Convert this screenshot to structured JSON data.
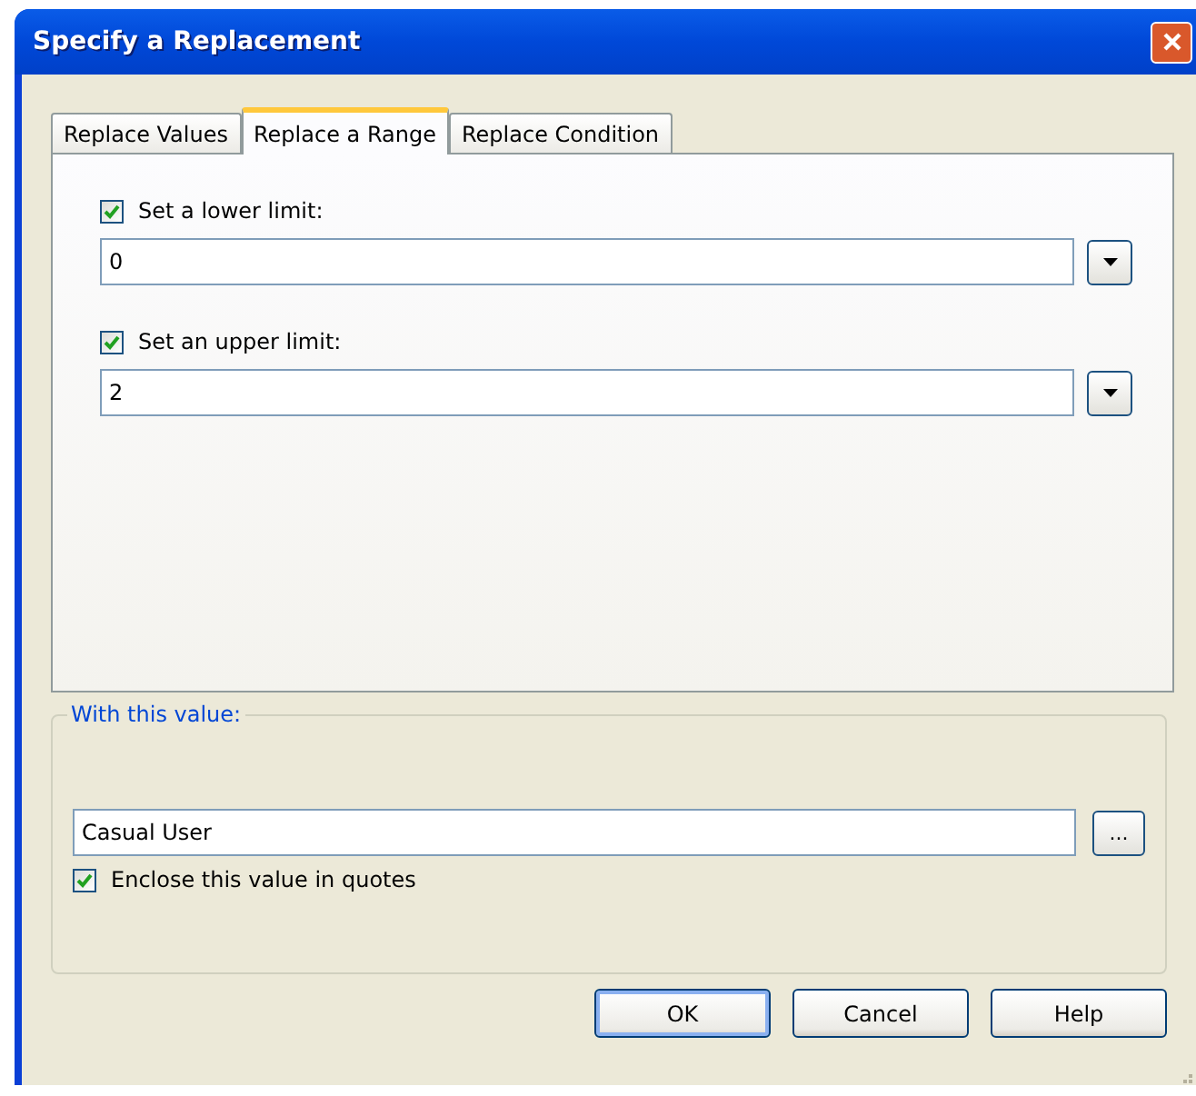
{
  "window": {
    "title": "Specify a Replacement"
  },
  "tabs": [
    {
      "label": "Replace Values",
      "selected": false
    },
    {
      "label": "Replace a Range",
      "selected": true
    },
    {
      "label": "Replace Condition",
      "selected": false
    }
  ],
  "limits": [
    {
      "label": "Set a lower limit:",
      "checked": true,
      "value": "0"
    },
    {
      "label": "Set an upper limit:",
      "checked": true,
      "value": "2"
    }
  ],
  "replacement": {
    "legend": "With this value:",
    "value": "Casual User",
    "browse": "...",
    "quotes": {
      "label": "Enclose this value in quotes",
      "checked": true
    }
  },
  "buttons": [
    {
      "label": "OK",
      "default": true
    },
    {
      "label": "Cancel",
      "default": false
    },
    {
      "label": "Help",
      "default": false
    }
  ]
}
